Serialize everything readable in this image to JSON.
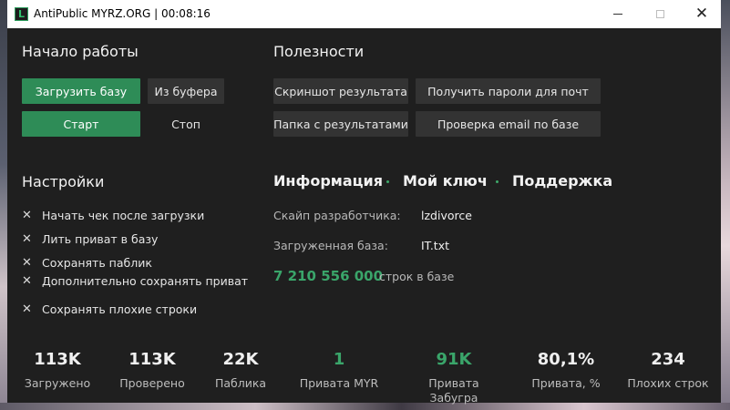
{
  "window": {
    "title": "AntiPublic MYRZ.ORG | 00:08:16",
    "icon_letter": "L",
    "accent": "#2e8c57"
  },
  "start": {
    "heading": "Начало работы",
    "load_base": "Загрузить базу",
    "from_clipboard": "Из буфера",
    "start": "Старт",
    "stop": "Стоп"
  },
  "utilities": {
    "heading": "Полезности",
    "screenshot": "Скриншот результата",
    "get_passwords": "Получить пароли для почт",
    "results_folder": "Папка с результатами",
    "check_email": "Проверка email по базе"
  },
  "settings": {
    "heading": "Настройки",
    "options": [
      "Начать чек после загрузки",
      "Лить приват в базу",
      "Сохранять паблик",
      "Дополнительно сохранять приват",
      "Сохранять плохие строки"
    ]
  },
  "info": {
    "tabs": [
      "Информация",
      "Мой ключ",
      "Поддержка"
    ],
    "dev_skype_label": "Скайп разработчика:",
    "dev_skype_value": "lzdivorce",
    "loaded_base_label": "Загруженная база:",
    "loaded_base_value": "IT.txt",
    "lines_count": "7 210 556 000",
    "lines_label": "строк в базе"
  },
  "stats": [
    {
      "value": "113K",
      "label": "Загружено"
    },
    {
      "value": "113K",
      "label": "Проверено"
    },
    {
      "value": "22K",
      "label": "Паблика"
    },
    {
      "value": "1",
      "label": "Привата MYR"
    },
    {
      "value": "91K",
      "label": "Привата Забугра"
    },
    {
      "value": "80,1%",
      "label": "Привата, %"
    },
    {
      "value": "234",
      "label": "Плохих строк"
    }
  ]
}
